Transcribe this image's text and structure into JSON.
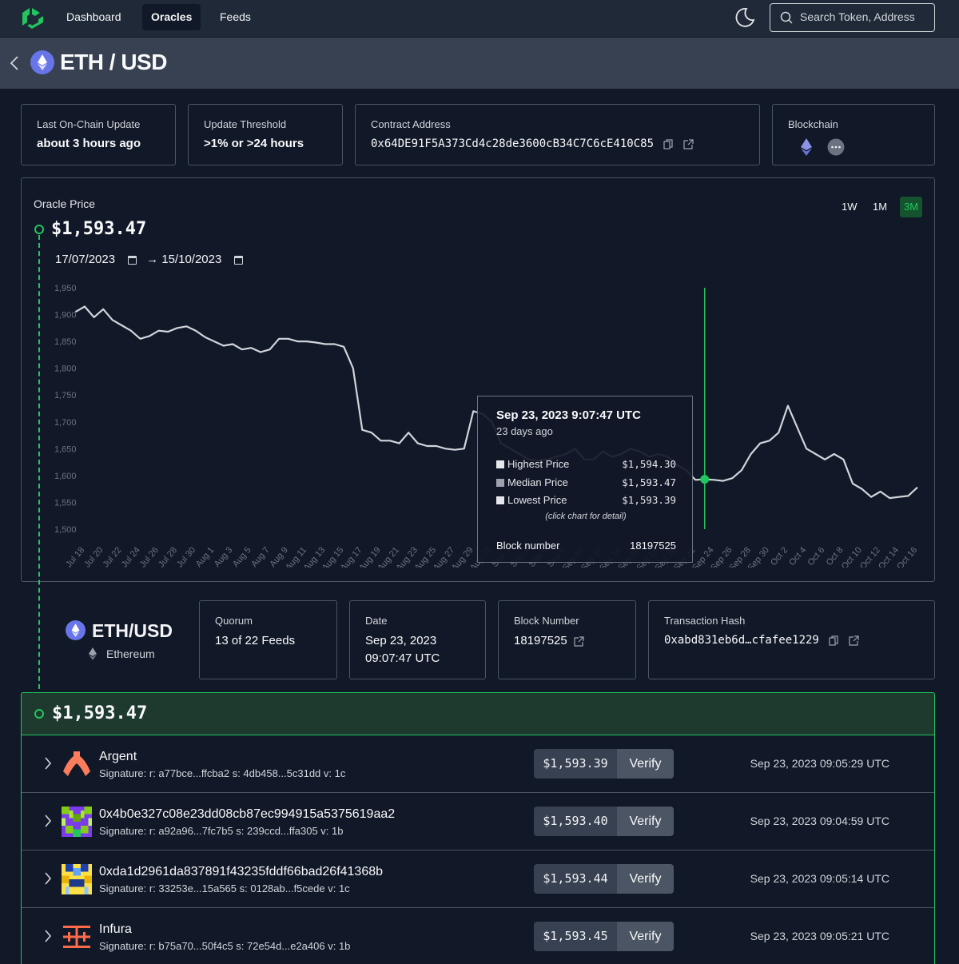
{
  "nav": {
    "items": [
      {
        "label": "Dashboard",
        "active": false
      },
      {
        "label": "Oracles",
        "active": true
      },
      {
        "label": "Feeds",
        "active": false
      }
    ],
    "search_placeholder": "Search Token, Address"
  },
  "header": {
    "title": "ETH / USD"
  },
  "cards": {
    "last_update": {
      "label": "Last On-Chain Update",
      "value": "about 3 hours ago"
    },
    "threshold": {
      "label": "Update Threshold",
      "value": ">1% or >24 hours"
    },
    "contract": {
      "label": "Contract Address",
      "value": "0x64DE91F5A373Cd4c28de3600cB34C7C6cE410C85"
    },
    "blockchain": {
      "label": "Blockchain",
      "icons": [
        "ethereum-icon",
        "more-icon"
      ]
    }
  },
  "oracle": {
    "label": "Oracle Price",
    "price": "$1,593.47",
    "date_from": "17/07/2023",
    "arrow": "→",
    "date_to": "15/10/2023",
    "ranges": [
      {
        "label": "1W",
        "active": false
      },
      {
        "label": "1M",
        "active": false
      },
      {
        "label": "3M",
        "active": true
      }
    ]
  },
  "chart_data": {
    "type": "line",
    "ylim": [
      1500,
      1950
    ],
    "yticks": [
      "1,950",
      "1,900",
      "1,850",
      "1,800",
      "1,750",
      "1,700",
      "1,650",
      "1,600",
      "1,550",
      "1,500"
    ],
    "xticks": [
      "Jul 18",
      "Jul 20",
      "Jul 22",
      "Jul 24",
      "Jul 26",
      "Jul 28",
      "Jul 30",
      "Aug 1",
      "Aug 3",
      "Aug 5",
      "Aug 7",
      "Aug 9",
      "Aug 11",
      "Aug 13",
      "Aug 15",
      "Aug 17",
      "Aug 19",
      "Aug 21",
      "Aug 23",
      "Aug 25",
      "Aug 27",
      "Aug 29",
      "Aug 31",
      "Sep 2",
      "Sep 4",
      "Sep 6",
      "Sep 8",
      "Sep 10",
      "Sep 12",
      "Sep 14",
      "Sep 16",
      "Sep 18",
      "Sep 20",
      "Sep 22",
      "Sep 24",
      "Sep 26",
      "Sep 28",
      "Sep 30",
      "Oct 2",
      "Oct 4",
      "Oct 6",
      "Oct 8",
      "Oct 10",
      "Oct 12",
      "Oct 14",
      "Oct 16"
    ],
    "series": [
      {
        "x": [
          "Jul 17",
          "Jul 18",
          "Jul 19",
          "Jul 20",
          "Jul 21",
          "Jul 22",
          "Jul 23",
          "Jul 24",
          "Jul 25",
          "Jul 26",
          "Jul 27",
          "Jul 28",
          "Jul 29",
          "Jul 30",
          "Jul 31",
          "Aug 1",
          "Aug 2",
          "Aug 3",
          "Aug 4",
          "Aug 5",
          "Aug 6",
          "Aug 7",
          "Aug 8",
          "Aug 9",
          "Aug 10",
          "Aug 11",
          "Aug 12",
          "Aug 13",
          "Aug 14",
          "Aug 15",
          "Aug 16",
          "Aug 17",
          "Aug 18",
          "Aug 19",
          "Aug 20",
          "Aug 21",
          "Aug 22",
          "Aug 23",
          "Aug 24",
          "Aug 25",
          "Aug 26",
          "Aug 27",
          "Aug 28",
          "Aug 29",
          "Aug 30",
          "Aug 31",
          "Sep 1",
          "Sep 2",
          "Sep 3",
          "Sep 4",
          "Sep 5",
          "Sep 6",
          "Sep 7",
          "Sep 8",
          "Sep 9",
          "Sep 10",
          "Sep 11",
          "Sep 12",
          "Sep 13",
          "Sep 14",
          "Sep 15",
          "Sep 16",
          "Sep 17",
          "Sep 18",
          "Sep 19",
          "Sep 20",
          "Sep 21",
          "Sep 22",
          "Sep 23",
          "Sep 24",
          "Sep 25",
          "Sep 26",
          "Sep 27",
          "Sep 28",
          "Sep 29",
          "Sep 30",
          "Oct 1",
          "Oct 2",
          "Oct 3",
          "Oct 4",
          "Oct 5",
          "Oct 6",
          "Oct 7",
          "Oct 8",
          "Oct 9",
          "Oct 10",
          "Oct 11",
          "Oct 12",
          "Oct 13",
          "Oct 14",
          "Oct 15",
          "Oct 16"
        ],
        "y": [
          1905,
          1915,
          1895,
          1910,
          1890,
          1880,
          1870,
          1855,
          1860,
          1870,
          1868,
          1875,
          1878,
          1870,
          1858,
          1850,
          1842,
          1845,
          1835,
          1838,
          1830,
          1835,
          1855,
          1855,
          1850,
          1850,
          1848,
          1845,
          1845,
          1840,
          1800,
          1685,
          1680,
          1665,
          1665,
          1660,
          1680,
          1660,
          1655,
          1655,
          1650,
          1648,
          1650,
          1720,
          1715,
          1700,
          1660,
          1650,
          1640,
          1630,
          1628,
          1630,
          1635,
          1640,
          1650,
          1630,
          1630,
          1645,
          1635,
          1640,
          1650,
          1645,
          1635,
          1640,
          1635,
          1620,
          1610,
          1592,
          1593,
          1592,
          1590,
          1595,
          1610,
          1640,
          1660,
          1665,
          1680,
          1730,
          1690,
          1650,
          1640,
          1630,
          1640,
          1630,
          1585,
          1575,
          1560,
          1570,
          1558,
          1560,
          1562,
          1578
        ]
      }
    ],
    "selected": {
      "x": "Sep 23"
    }
  },
  "tooltip": {
    "title": "Sep 23, 2023 9:07:47 UTC",
    "subtitle": "23 days ago",
    "rows": [
      {
        "label": "Highest Price",
        "value": "$1,594.30",
        "color": "#e5e7eb"
      },
      {
        "label": "Median Price",
        "value": "$1,593.47",
        "color": "#9ca3af"
      },
      {
        "label": "Lowest Price",
        "value": "$1,593.39",
        "color": "#e5e7eb"
      }
    ],
    "note": "(click chart for detail)",
    "block_label": "Block number",
    "block_value": "18197525"
  },
  "detail": {
    "pair": "ETH/USD",
    "chain": "Ethereum",
    "quorum": {
      "label": "Quorum",
      "value": "13 of 22 Feeds"
    },
    "date": {
      "label": "Date",
      "line1": "Sep 23, 2023",
      "line2": "09:07:47 UTC"
    },
    "block": {
      "label": "Block Number",
      "value": "18197525"
    },
    "tx": {
      "label": "Transaction Hash",
      "value": "0xabd831eb6d…cfafee1229"
    }
  },
  "feeds": {
    "aggregate_price": "$1,593.47",
    "verify_label": "Verify",
    "rows": [
      {
        "name": "Argent",
        "signature": "Signature:  r: a77bce...ffcba2  s: 4db458...5c31dd  v: 1c",
        "price": "$1,593.39",
        "time": "Sep 23, 2023 09:05:29 UTC",
        "avatar": "argent-logo"
      },
      {
        "name": "0x4b0e327c08e23dd08cb87ec994915a5375619aa2",
        "signature": "Signature:  r: a92a96...7fc7b5  s: 239ccd...ffa305  v: 1b",
        "price": "$1,593.40",
        "time": "Sep 23, 2023 09:04:59 UTC",
        "avatar": "identicon"
      },
      {
        "name": "0xda1d2961da837891f43235fddf66bad26f41368b",
        "signature": "Signature:  r: 33253e...15a565  s: 0128ab...f5cede  v: 1c",
        "price": "$1,593.44",
        "time": "Sep 23, 2023 09:05:14 UTC",
        "avatar": "identicon"
      },
      {
        "name": "Infura",
        "signature": "Signature:  r: b75a70...50f4c5  s: 72e54d...e2a406  v: 1b",
        "price": "$1,593.45",
        "time": "Sep 23, 2023 09:05:21 UTC",
        "avatar": "infura-logo"
      }
    ]
  }
}
